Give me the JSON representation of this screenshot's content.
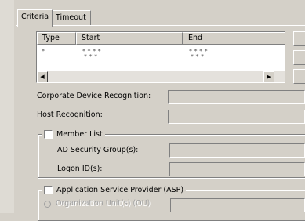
{
  "tabs": [
    {
      "label": "Criteria",
      "active": true
    },
    {
      "label": "Timeout",
      "active": false
    }
  ],
  "list": {
    "columns": [
      "Type",
      "Start",
      "End"
    ],
    "rows": [
      {
        "type": "*",
        "start": "* * * *",
        "end": "* * * *"
      },
      {
        "type": "",
        "start": "* * *",
        "end": "* * *"
      }
    ],
    "scroll_left_glyph": "◀",
    "scroll_right_glyph": "▶"
  },
  "form": {
    "corporate_device_label": "Corporate Device Recognition:",
    "corporate_device_value": "",
    "host_recognition_label": "Host Recognition:",
    "host_recognition_value": "",
    "member_list_label": "Member List",
    "member_list_checked": false,
    "ad_security_groups_label": "AD Security Group(s):",
    "ad_security_groups_value": "",
    "logon_ids_label": "Logon ID(s):",
    "logon_ids_value": "",
    "asp_label": "Application Service Provider (ASP)",
    "asp_checked": false,
    "org_units_label": "Organization Unit(s) (OU)",
    "org_units_value": ""
  }
}
